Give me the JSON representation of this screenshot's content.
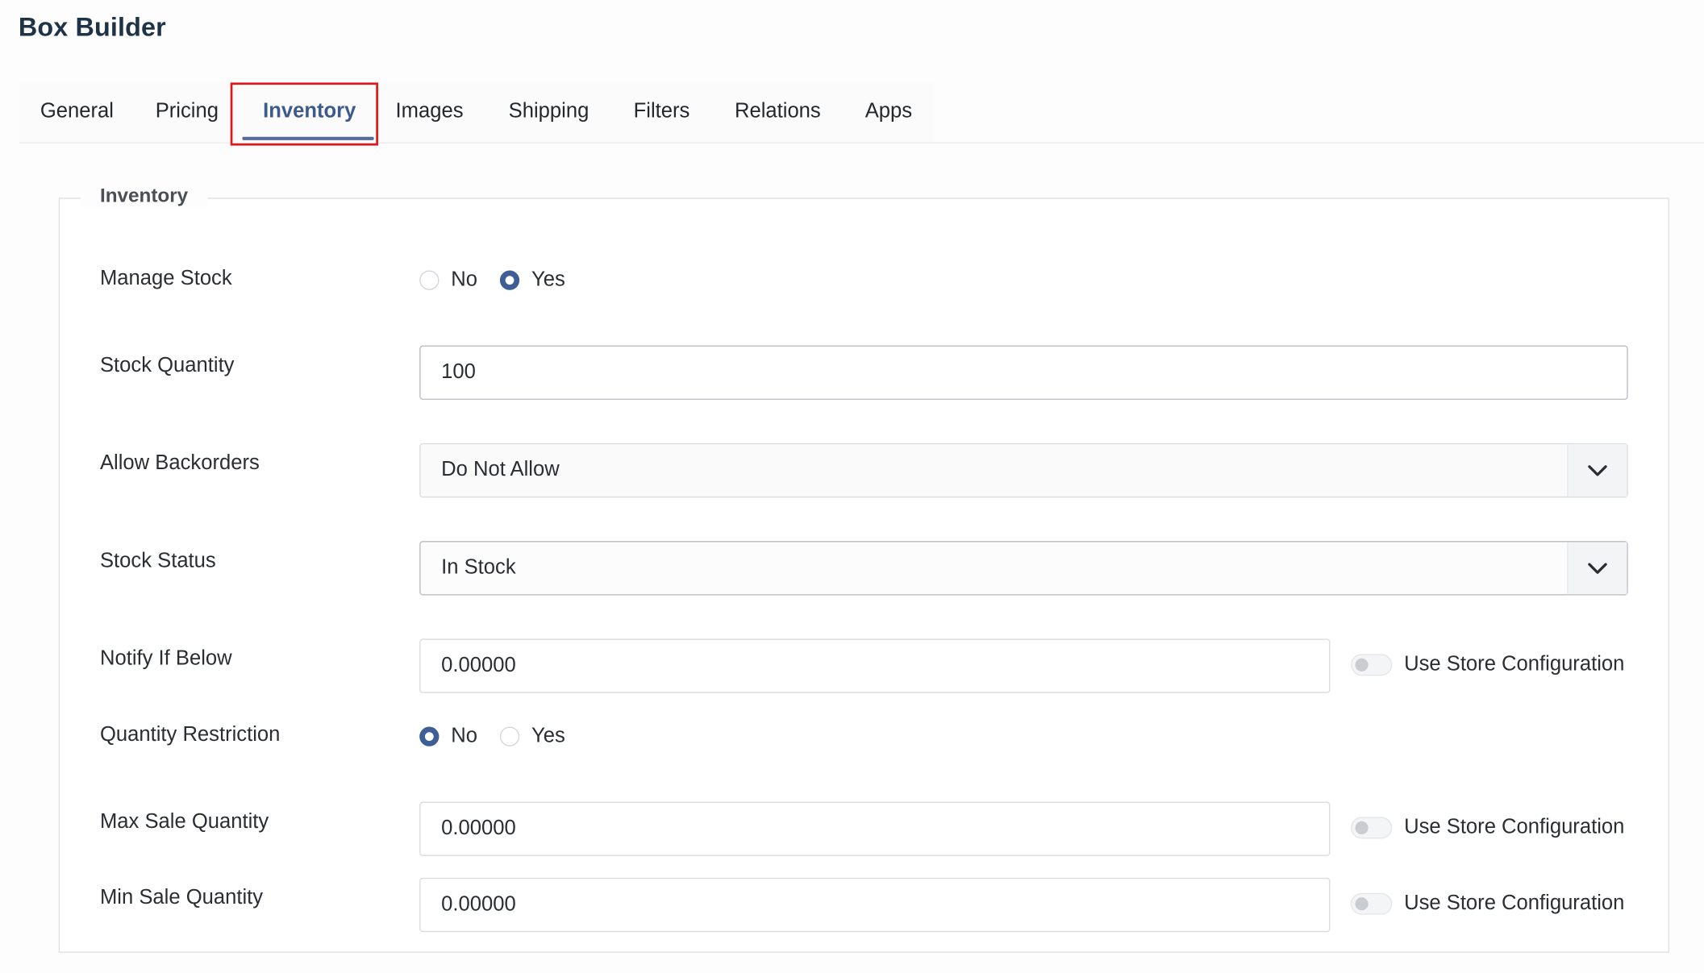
{
  "page": {
    "title": "Box Builder"
  },
  "tabs": [
    {
      "label": "General"
    },
    {
      "label": "Pricing"
    },
    {
      "label": "Inventory",
      "active": true
    },
    {
      "label": "Images"
    },
    {
      "label": "Shipping"
    },
    {
      "label": "Filters"
    },
    {
      "label": "Relations"
    },
    {
      "label": "Apps"
    }
  ],
  "inventory": {
    "legend": "Inventory",
    "manage_stock": {
      "label": "Manage Stock",
      "options": [
        "No",
        "Yes"
      ],
      "selected": "Yes"
    },
    "stock_quantity": {
      "label": "Stock Quantity",
      "value": "100"
    },
    "allow_backorders": {
      "label": "Allow Backorders",
      "value": "Do Not Allow"
    },
    "stock_status": {
      "label": "Stock Status",
      "value": "In Stock"
    },
    "notify_if_below": {
      "label": "Notify If Below",
      "value": "0.00000",
      "toggle_label": "Use Store Configuration",
      "toggle_on": false
    },
    "quantity_restriction": {
      "label": "Quantity Restriction",
      "options": [
        "No",
        "Yes"
      ],
      "selected": "No"
    },
    "max_sale_quantity": {
      "label": "Max Sale Quantity",
      "value": "0.00000",
      "toggle_label": "Use Store Configuration",
      "toggle_on": false
    },
    "min_sale_quantity": {
      "label": "Min Sale Quantity",
      "value": "0.00000",
      "toggle_label": "Use Store Configuration",
      "toggle_on": false
    }
  },
  "colors": {
    "accent": "#3e5e96",
    "highlight": "#e0171a",
    "title": "#1f3347"
  },
  "icons": {
    "select_caret": "chevron-down-icon",
    "highlight": "red-annotation-box"
  }
}
